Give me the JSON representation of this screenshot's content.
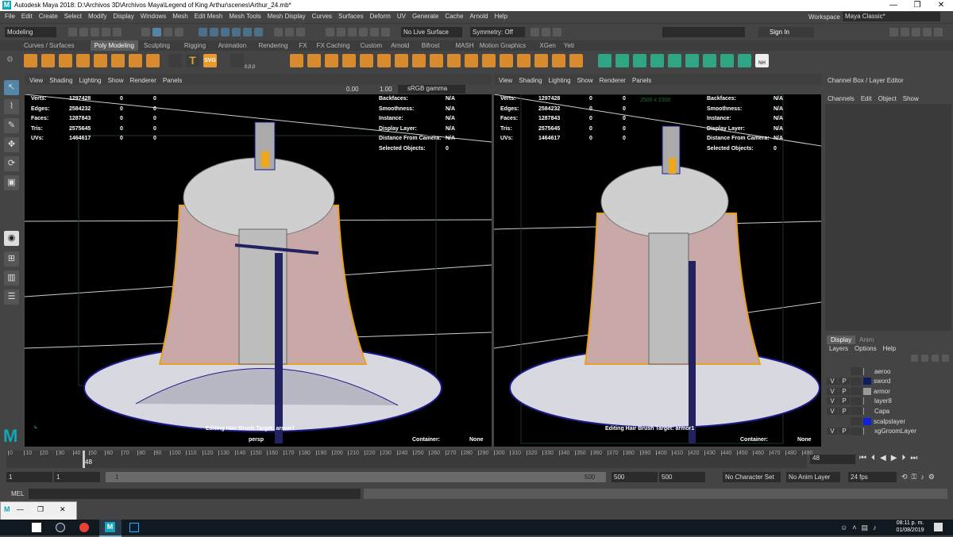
{
  "window": {
    "title": "Autodesk Maya 2018: D:\\Archivos 3D\\Archivos Maya\\Legend of King Arthur\\scenes\\Arthur_24.mb*",
    "logo": "M",
    "controls": [
      "—",
      "❐",
      "✕"
    ]
  },
  "menu": [
    "File",
    "Edit",
    "Create",
    "Select",
    "Modify",
    "Display",
    "Windows",
    "Mesh",
    "Edit Mesh",
    "Mesh Tools",
    "Mesh Display",
    "Curves",
    "Surfaces",
    "Deform",
    "UV",
    "Generate",
    "Cache",
    "Arnold",
    "Help"
  ],
  "workspace": {
    "label": "Workspace :",
    "value": "Maya Classic*"
  },
  "status": {
    "mode": "Modeling",
    "live_surface": "No Live Surface",
    "symmetry": "Symmetry: Off",
    "sign_in": "Sign In"
  },
  "shelf_tabs": [
    "Curves / Surfaces",
    "Poly Modeling",
    "Sculpting",
    "Rigging",
    "Animation",
    "Rendering",
    "FX",
    "FX Caching",
    "Custom",
    "Arnold",
    "Bifrost",
    "MASH",
    "Motion Graphics",
    "XGen",
    "Yeti"
  ],
  "shelf_active": "Poly Modeling",
  "shelf_icon_text": {
    "svg": "SVG",
    "text": "T",
    "nh": "NH",
    "coords": "0,0,0"
  },
  "viewport_menu": [
    "View",
    "Shading",
    "Lighting",
    "Show",
    "Renderer",
    "Panels"
  ],
  "viewport_toolbar": {
    "value_a": "0.00",
    "value_b": "1.00",
    "color_space": "sRGB gamma"
  },
  "hud_left": [
    {
      "label": "Verts:",
      "v1": "1297428",
      "v2": "0",
      "v3": "0"
    },
    {
      "label": "Edges:",
      "v1": "2584232",
      "v2": "0",
      "v3": "0"
    },
    {
      "label": "Faces:",
      "v1": "1287843",
      "v2": "0",
      "v3": "0"
    },
    {
      "label": "Tris:",
      "v1": "2575645",
      "v2": "0",
      "v3": "0"
    },
    {
      "label": "UVs:",
      "v1": "1464617",
      "v2": "0",
      "v3": "0"
    }
  ],
  "hud_right": [
    {
      "label": "Backfaces:",
      "value": "N/A"
    },
    {
      "label": "Smoothness:",
      "value": "N/A"
    },
    {
      "label": "Instance:",
      "value": "N/A"
    },
    {
      "label": "Display Layer:",
      "value": "N/A"
    },
    {
      "label": "Distance From Camera:",
      "value": "N/A"
    },
    {
      "label": "Selected Objects:",
      "value": "0"
    }
  ],
  "resolution_gate": "2500 x 2300",
  "hud_bottom": {
    "caption": "Editing Hair Brush Target: armor1",
    "label2": "persp",
    "container_label": "Container:",
    "container_value": "None"
  },
  "channel_box": {
    "title": "Channel Box / Layer Editor",
    "menu": [
      "Channels",
      "Edit",
      "Object",
      "Show"
    ]
  },
  "layer_editor": {
    "tabs": [
      "Display",
      "Anim"
    ],
    "menu": [
      "Layers",
      "Options",
      "Help"
    ],
    "layers": [
      {
        "v": "",
        "p": "",
        "color": "",
        "name": "aeroo"
      },
      {
        "v": "V",
        "p": "P",
        "color": "#101c60",
        "name": "sword"
      },
      {
        "v": "V",
        "p": "P",
        "color": "#9a9a9a",
        "name": "armor"
      },
      {
        "v": "V",
        "p": "P",
        "color": "",
        "name": "layer8"
      },
      {
        "v": "V",
        "p": "P",
        "color": "",
        "name": "Capa"
      },
      {
        "v": "",
        "p": "",
        "color": "#1020e0",
        "name": "scalpslayer"
      },
      {
        "v": "V",
        "p": "P",
        "color": "",
        "name": "xgGroomLayer"
      }
    ]
  },
  "timeline": {
    "ticks": [
      "0",
      "10",
      "20",
      "30",
      "40",
      "50",
      "60",
      "70",
      "80",
      "90",
      "100",
      "110",
      "120",
      "130",
      "140",
      "150",
      "160",
      "170",
      "180",
      "190",
      "200",
      "210",
      "220",
      "230",
      "240",
      "250",
      "260",
      "270",
      "280",
      "290",
      "300",
      "310",
      "320",
      "330",
      "340",
      "350",
      "360",
      "370",
      "380",
      "390",
      "400",
      "410",
      "420",
      "430",
      "440",
      "450",
      "460",
      "470",
      "480",
      "490"
    ],
    "current": "48",
    "current_field": "48"
  },
  "range": {
    "start": "1",
    "start2": "1",
    "slider_start": "1",
    "slider_end": "500",
    "end": "500",
    "end2": "500",
    "character_set": "No Character Set",
    "anim_layer": "No Anim Layer",
    "fps": "24 fps"
  },
  "command_line": {
    "label": "MEL"
  },
  "taskbar": {
    "time": "08:11 p. m.",
    "date": "01/08/2019"
  },
  "colors": {
    "accent": "#5285a6",
    "wire_blue": "#1a1a8c",
    "wire_orange": "#e8a020",
    "maya_teal": "#11a7b9"
  }
}
